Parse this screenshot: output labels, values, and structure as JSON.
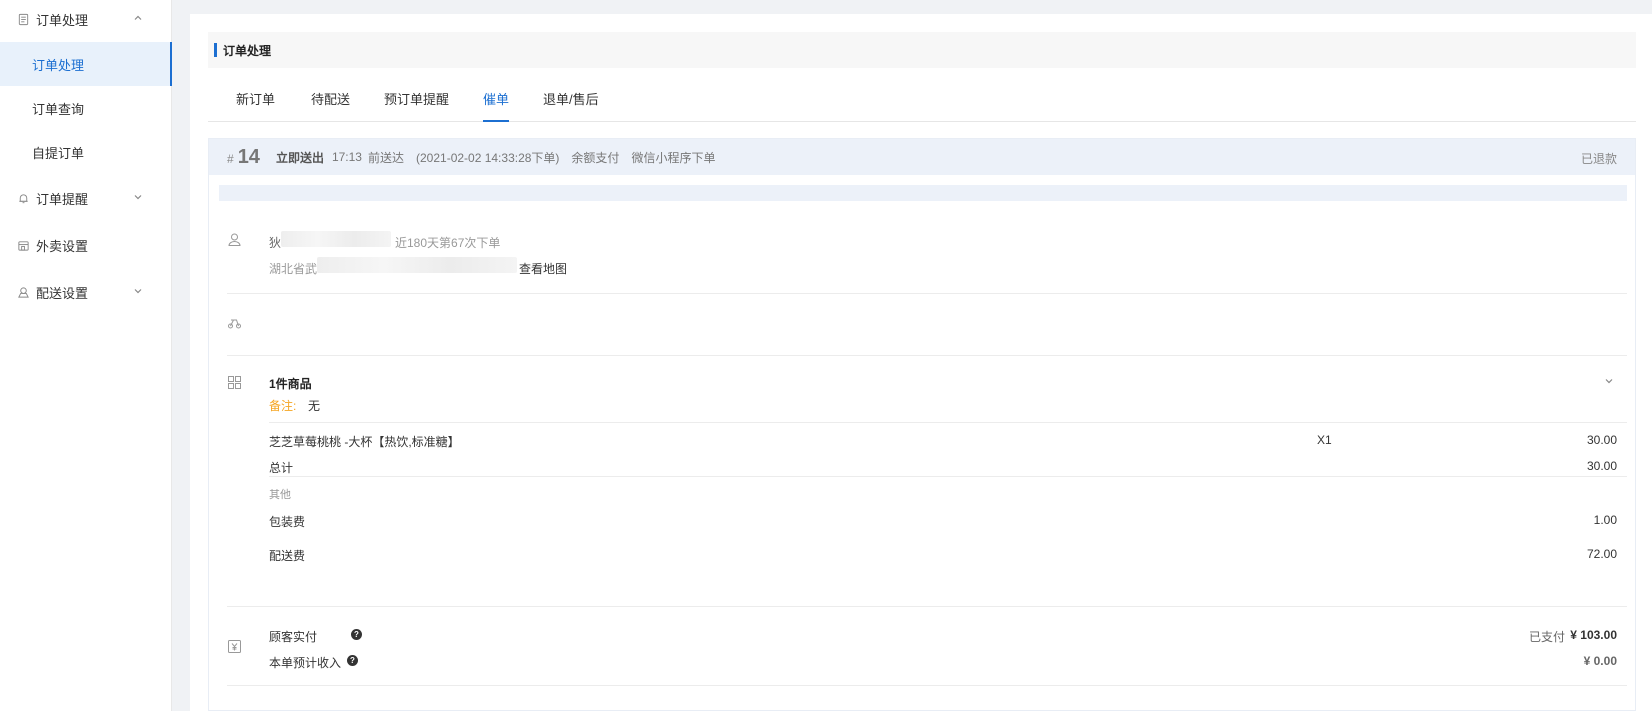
{
  "sidebar": {
    "groups": [
      {
        "label": "订单处理",
        "icon": "document-icon",
        "expanded": true
      },
      {
        "label": "订单提醒",
        "icon": "bell-icon",
        "expanded": false
      },
      {
        "label": "外卖设置",
        "icon": "store-icon"
      },
      {
        "label": "配送设置",
        "icon": "delivery-icon",
        "expanded": false
      }
    ],
    "sub_items": [
      {
        "label": "订单处理",
        "active": true
      },
      {
        "label": "订单查询"
      },
      {
        "label": "自提订单"
      }
    ]
  },
  "page": {
    "title": "订单处理"
  },
  "tabs": [
    {
      "label": "新订单"
    },
    {
      "label": "待配送"
    },
    {
      "label": "预订单提醒"
    },
    {
      "label": "催单",
      "active": true
    },
    {
      "label": "退单/售后"
    }
  ],
  "order": {
    "hash": "#",
    "number": "14",
    "delivery_mode": "立即送出",
    "time": "17:13",
    "time_suffix": "前送达",
    "placed_at": "(2021-02-02 14:33:28下单)",
    "payment": "余额支付",
    "channel": "微信小程序下单",
    "status": "已退款",
    "customer": {
      "name_initial": "狄",
      "order_count": "近180天第67次下单",
      "address_prefix": "湖北省武",
      "map_link": "查看地图"
    },
    "items_section": {
      "count_label": "1件商品",
      "note_label": "备注:",
      "note_value": "无",
      "items": [
        {
          "name": "芝芝草莓桃桃 -大杯【热饮,标准糖】",
          "qty": "X1",
          "price": "30.00"
        }
      ],
      "total_label": "总计",
      "total_value": "30.00",
      "other_label": "其他",
      "fees": [
        {
          "label": "包装费",
          "value": "1.00"
        },
        {
          "label": "配送费",
          "value": "72.00"
        }
      ]
    },
    "payment_section": {
      "paid_label": "顾客实付",
      "paid_status": "已支付",
      "paid_amount": "¥ 103.00",
      "income_label": "本单预计收入",
      "income_amount": "¥ 0.00"
    }
  },
  "colors": {
    "accent": "#1c6fd1",
    "note": "#f5a623",
    "header_bg": "#ecf1f9"
  }
}
